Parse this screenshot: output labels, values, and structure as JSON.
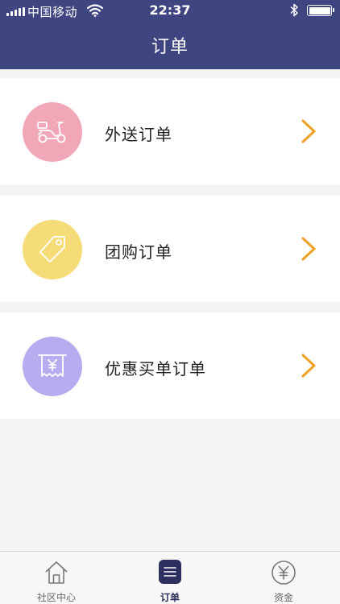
{
  "status_bar": {
    "carrier": "中国移动",
    "time": "22:37"
  },
  "header": {
    "title": "订单"
  },
  "orders": [
    {
      "label": "外送订单",
      "icon": "scooter-icon",
      "color": "#f2a7b8"
    },
    {
      "label": "团购订单",
      "icon": "tag-icon",
      "color": "#f6dc78"
    },
    {
      "label": "优惠买单订单",
      "icon": "receipt-icon",
      "color": "#b8abef"
    }
  ],
  "tab_bar": {
    "items": [
      {
        "label": "社区中心",
        "icon": "home-icon"
      },
      {
        "label": "订单",
        "icon": "list-icon",
        "active": true
      },
      {
        "label": "资金",
        "icon": "yen-icon"
      }
    ]
  },
  "colors": {
    "header_bg": "#3f4581",
    "chevron": "#f0a020",
    "tab_active": "#2d2f5e"
  }
}
